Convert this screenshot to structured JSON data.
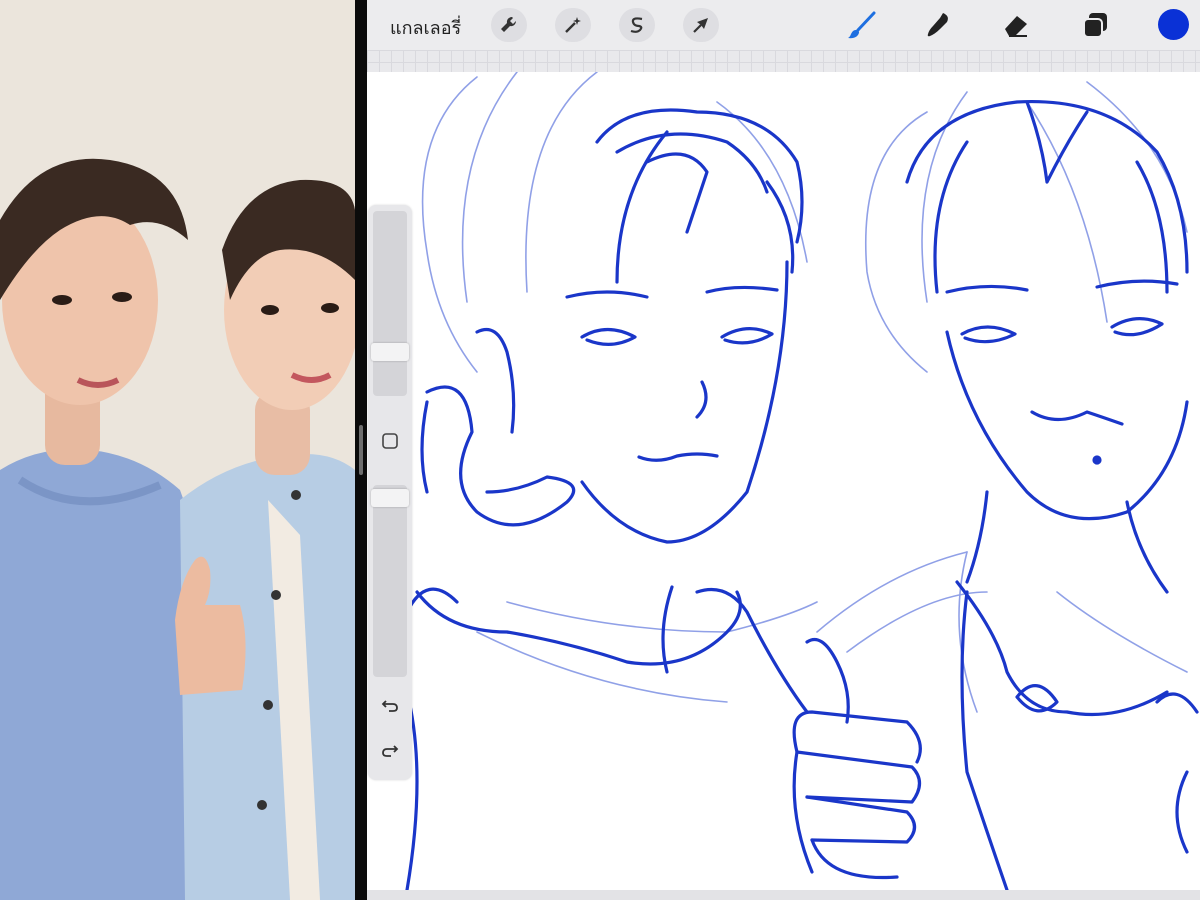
{
  "toolbar": {
    "gallery_label": "แกลเลอรี่",
    "left_tools": [
      {
        "icon": "wrench-icon"
      },
      {
        "icon": "magic-wand-icon"
      },
      {
        "icon": "selection-s-icon"
      },
      {
        "icon": "arrow-cursor-icon"
      }
    ],
    "right_tools": [
      {
        "icon": "brush-icon"
      },
      {
        "icon": "smudge-icon"
      },
      {
        "icon": "eraser-icon"
      },
      {
        "icon": "layers-icon"
      }
    ],
    "current_color": "#0a31d6"
  },
  "sidebar": {
    "brush_size_level": 0.75,
    "opacity_level": 0.05,
    "icons": [
      "modify-square-icon",
      "undo-icon",
      "redo-icon"
    ]
  },
  "colors": {
    "ink": "#1533c8",
    "ink_light": "#6f83e0",
    "app_bg": "#ececee"
  }
}
